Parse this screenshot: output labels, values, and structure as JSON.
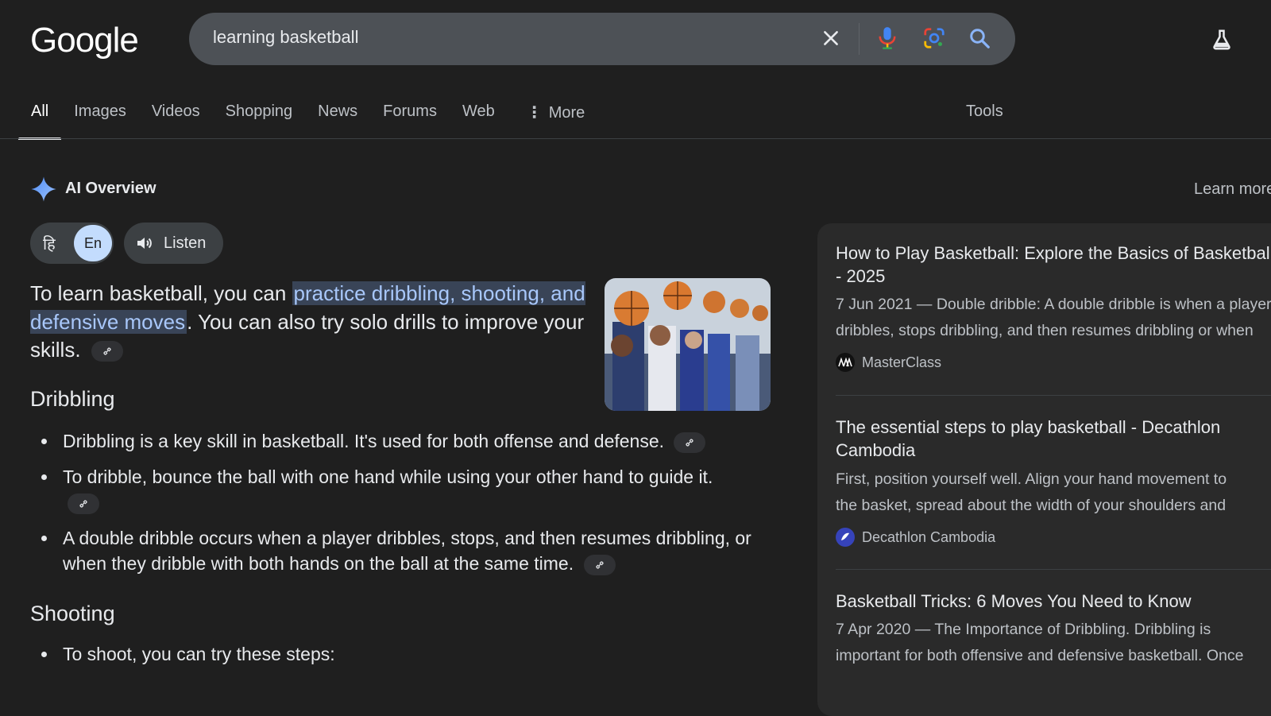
{
  "header": {
    "logo_text": "Google",
    "search_query": "learning basketball",
    "icons": [
      "clear-icon",
      "microphone-icon",
      "lens-icon",
      "search-icon",
      "labs-icon"
    ]
  },
  "tabs": [
    {
      "label": "All",
      "active": true
    },
    {
      "label": "Images"
    },
    {
      "label": "Videos"
    },
    {
      "label": "Shopping"
    },
    {
      "label": "News"
    },
    {
      "label": "Forums"
    },
    {
      "label": "Web"
    },
    {
      "label": "More"
    }
  ],
  "tools_label": "Tools",
  "ai_overview": {
    "title": "AI Overview",
    "learn_more": "Learn more",
    "lang_hi": "हि",
    "lang_en": "En",
    "listen": "Listen",
    "intro_before": "To learn basketball, you can ",
    "intro_highlight": "practice dribbling, shooting, and defensive moves",
    "intro_after": ". You can also try solo drills to improve your skills.",
    "sections": [
      {
        "heading": "Dribbling",
        "bullets": [
          "Dribbling is a key skill in basketball. It's used for both offense and defense.",
          "To dribble, bounce the ball with one hand while using your other hand to guide it.",
          "A double dribble occurs when a player dribbles, stops, and then resumes dribbling, or when they dribble with both hands on the ball at the same time."
        ]
      },
      {
        "heading": "Shooting",
        "bullets": [
          "To shoot, you can try these steps:"
        ]
      }
    ]
  },
  "sources": [
    {
      "title": "How to Play Basketball: Explore the Basics of Basketball - 2025",
      "snippet_1": "7 Jun 2021 — Double dribble: A double dribble is when a player",
      "snippet_2": "dribbles, stops dribbling, and then resumes dribbling or when",
      "site": "MasterClass"
    },
    {
      "title": "The essential steps to play basketball - Decathlon Cambodia",
      "snippet_1": "First, position yourself well. Align your hand movement to",
      "snippet_2": "the basket, spread about the width of your shoulders and",
      "site": "Decathlon Cambodia"
    },
    {
      "title": "Basketball Tricks: 6 Moves You Need to Know",
      "snippet_1": "7 Apr 2020 — The Importance of Dribbling. Dribbling is",
      "snippet_2": "important for both offensive and defensive basketball. Once",
      "site": ""
    }
  ],
  "colors": {
    "background": "#1f1f1f",
    "search_box": "#4d5156",
    "highlight_bg": "#394457",
    "highlight_text": "#a8c7fa",
    "lang_active": "#c3dcfd"
  }
}
